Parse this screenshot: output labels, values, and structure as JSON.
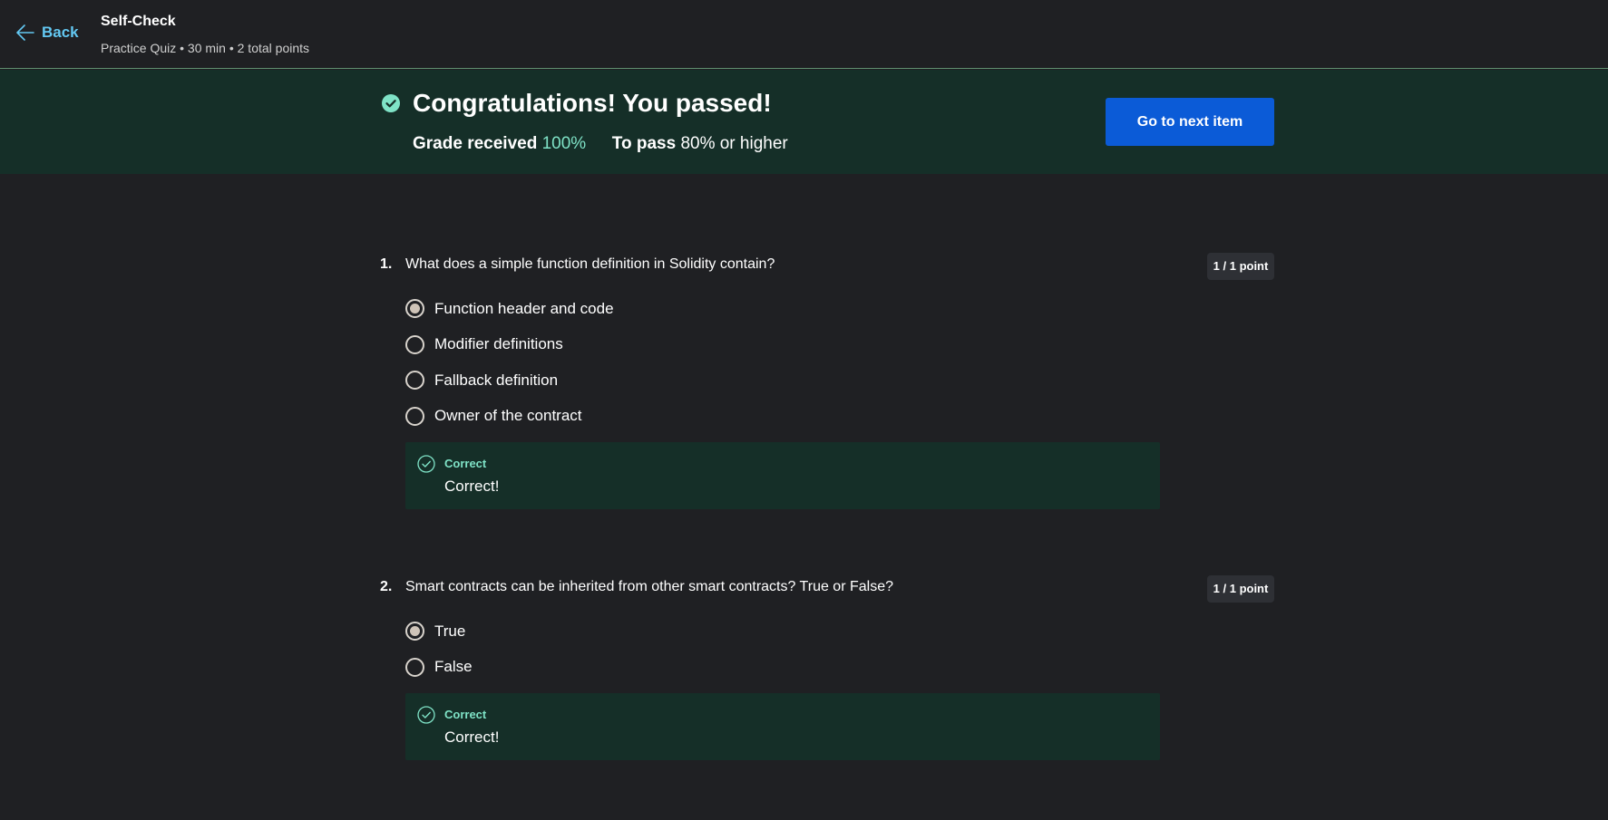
{
  "header": {
    "back_label": "Back",
    "title": "Self-Check",
    "subtitle": "Practice Quiz • 30 min • 2 total points"
  },
  "banner": {
    "heading": "Congratulations! You passed!",
    "grade_label": "Grade received",
    "grade_value": "100%",
    "pass_label": "To pass",
    "pass_value": "80% or higher",
    "next_button_label": "Go to next item"
  },
  "questions": [
    {
      "number": "1.",
      "text": "What does a simple function definition in Solidity contain?",
      "points": "1 / 1 point",
      "options": [
        {
          "label": "Function header and code",
          "selected": true
        },
        {
          "label": "Modifier definitions",
          "selected": false
        },
        {
          "label": "Fallback definition",
          "selected": false
        },
        {
          "label": "Owner of the contract",
          "selected": false
        }
      ],
      "feedback": {
        "title": "Correct",
        "text": "Correct!"
      }
    },
    {
      "number": "2.",
      "text": "Smart contracts can be inherited from other smart contracts? True or False?",
      "points": "1 / 1 point",
      "options": [
        {
          "label": "True",
          "selected": true
        },
        {
          "label": "False",
          "selected": false
        }
      ],
      "feedback": {
        "title": "Correct",
        "text": "Correct!"
      }
    }
  ],
  "colors": {
    "background": "#1f2023",
    "banner_bg": "#152f28",
    "accent_link": "#63c8f2",
    "success": "#7fe3c7",
    "primary_button": "#0b5bd7"
  },
  "icons": {
    "back": "arrow-left-icon",
    "passed": "check-circle-filled-icon",
    "feedback": "check-circle-outline-icon",
    "radio": "radio-button-icon"
  }
}
